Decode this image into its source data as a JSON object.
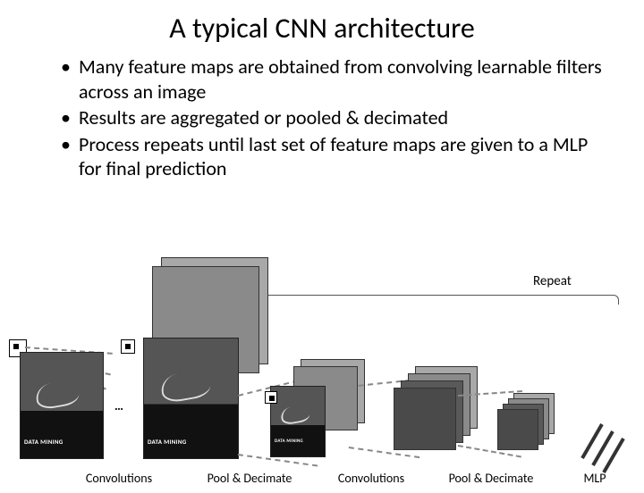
{
  "title": "A typical CNN architecture",
  "bullets": [
    "Many feature maps are obtained from convolving learnable filters across an image",
    "Results are aggregated or pooled & decimated",
    "Process repeats until last set of feature maps are given to a MLP for final prediction"
  ],
  "repeat_label": "Repeat",
  "stages": {
    "conv1": "Convolutions",
    "pool1": "Pool & Decimate",
    "conv2": "Convolutions",
    "pool2": "Pool & Decimate",
    "mlp": "MLP"
  },
  "book_title": "DATA MINING",
  "ellipsis": "…"
}
